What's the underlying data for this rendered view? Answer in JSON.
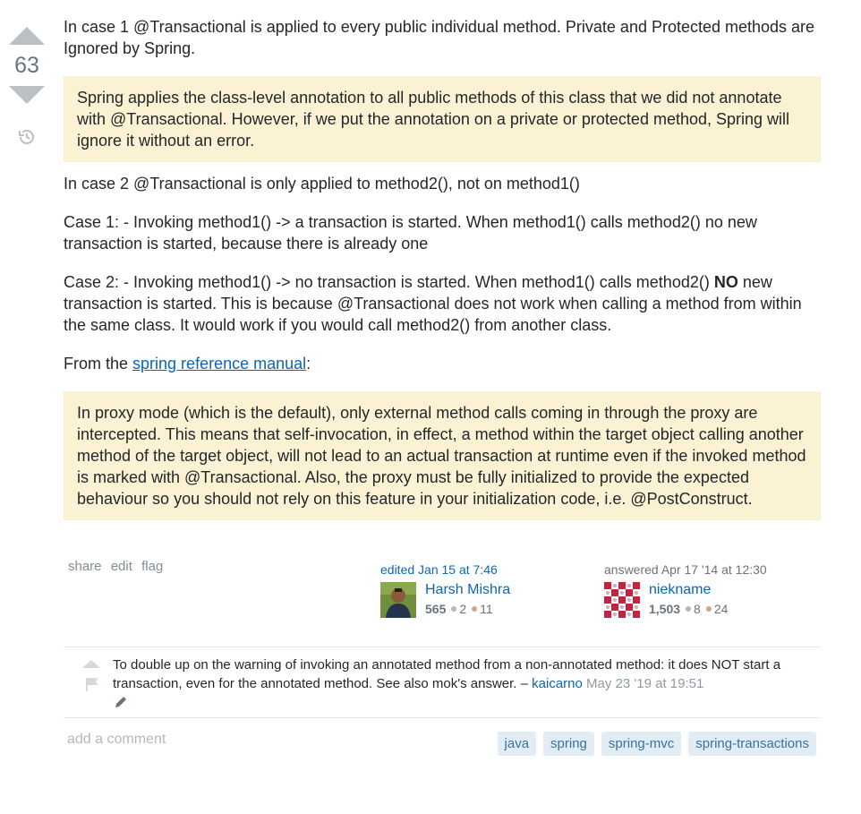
{
  "vote": {
    "count": "63"
  },
  "post": {
    "p1": "In case 1 @Transactional is applied to every public individual method. Private and Protected methods are Ignored by Spring.",
    "quote1": "Spring applies the class-level annotation to all public methods of this class that we did not annotate with @Transactional. However, if we put the annotation on a private or protected method, Spring will ignore it without an error.",
    "p2": "In case 2 @Transactional is only applied to method2(), not on method1()",
    "case1_label": "Case 1:",
    "case1_text": " - Invoking method1() -> a transaction is started. When method1() calls method2() no new transaction is started, because there is already one",
    "case2_label": "Case 2:",
    "case2_text_a": " - Invoking method1() -> no transaction is started. When method1() calls method2() ",
    "case2_bold": "NO",
    "case2_text_b": " new transaction is started. This is because @Transactional does not work when calling a method from within the same class. It would work if you would call method2() from another class.",
    "from_prefix": "From the ",
    "from_link": "spring reference manual",
    "from_suffix": ":",
    "quote2": "In proxy mode (which is the default), only external method calls coming in through the proxy are intercepted. This means that self-invocation, in effect, a method within the target object calling another method of the target object, will not lead to an actual transaction at runtime even if the invoked method is marked with @Transactional. Also, the proxy must be fully initialized to provide the expected behaviour so you should not rely on this feature in your initialization code, i.e. @PostConstruct."
  },
  "menu": {
    "share": "share",
    "edit": "edit",
    "flag": "flag"
  },
  "editor": {
    "action": "edited Jan 15 at 7:46",
    "name": "Harsh Mishra",
    "rep": "565",
    "silver": "2",
    "bronze": "11"
  },
  "answerer": {
    "action": "answered Apr 17 '14 at 12:30",
    "name": "niekname",
    "rep": "1,503",
    "silver": "8",
    "bronze": "24"
  },
  "comment": {
    "text": "To double up on the warning of invoking an annotated method from a non-annotated method: it does NOT start a transaction, even for the annotated method. See also mok's answer. – ",
    "user": "kaicarno",
    "time": "May 23 '19 at 19:51"
  },
  "add_comment": "add a comment",
  "tags": [
    "java",
    "spring",
    "spring-mvc",
    "spring-transactions"
  ],
  "colors": {
    "quote_bg": "#fbf2d4",
    "link": "#0c65b5",
    "tag_bg": "#e1ecf4",
    "tag_text": "#39739d"
  }
}
